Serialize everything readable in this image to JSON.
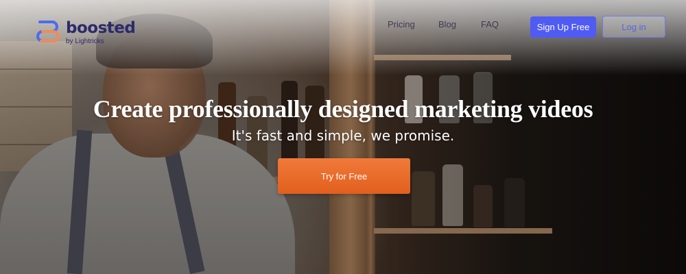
{
  "brand": {
    "name": "boosted",
    "byline": "by Lightricks",
    "logo_colors": {
      "top": "#4a6cf0",
      "bottom": "#f08a5a"
    }
  },
  "nav": {
    "links": [
      {
        "label": "Pricing"
      },
      {
        "label": "Blog"
      },
      {
        "label": "FAQ"
      }
    ],
    "signup_label": "Sign Up Free",
    "login_label": "Log in"
  },
  "hero": {
    "headline": "Create professionally designed marketing videos",
    "subheadline": "It's fast and simple, we promise.",
    "cta_label": "Try for Free"
  },
  "colors": {
    "primary_button": "#4f5bf3",
    "cta_button": "#e8682a",
    "brand_text": "#2c2a6b"
  }
}
